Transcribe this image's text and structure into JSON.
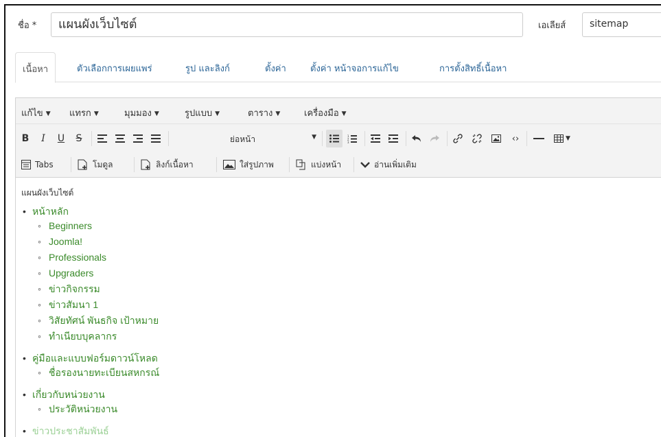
{
  "form": {
    "title_label": "ชื่อ *",
    "title_value": "แผนผังเว็บไซต์",
    "alias_label": "เอเลียส์",
    "alias_value": "sitemap"
  },
  "tabs": [
    {
      "label": "เนื้อหา",
      "active": true
    },
    {
      "label": "ตัวเลือกการเผยแพร่",
      "active": false
    },
    {
      "label": "รูป และลิงก์",
      "active": false
    },
    {
      "label": "ตั้งค่า",
      "active": false
    },
    {
      "label": "ตั้งค่า หน้าจอการแก้ไข",
      "active": false
    },
    {
      "label": "การตั้งสิทธิ์เนื้อหา",
      "active": false
    }
  ],
  "editor": {
    "menus": [
      "แก้ไข",
      "แทรก",
      "มุมมอง",
      "รูปแบบ",
      "ตาราง",
      "เครื่องมือ"
    ],
    "format_select": "ย่อหน้า",
    "buttons_row2": [
      {
        "label": "Tabs",
        "icon": "tabs-icon"
      },
      {
        "label": "โมดูล",
        "icon": "module-icon"
      },
      {
        "label": "ลิงก์เนื้อหา",
        "icon": "article-link-icon"
      },
      {
        "label": "ใส่รูปภาพ",
        "icon": "image-icon"
      },
      {
        "label": "แบ่งหน้า",
        "icon": "pagebreak-icon"
      },
      {
        "label": "อ่านเพิ่มเติม",
        "icon": "readmore-icon"
      }
    ]
  },
  "content": {
    "heading": "แผนผังเว็บไซต์",
    "sections": [
      {
        "label": "หน้าหลัก",
        "children": [
          "Beginners",
          "Joomla!",
          "Professionals",
          "Upgraders",
          "ข่าวกิจกรรม",
          "ข่าวสัมนา 1",
          "วิสัยทัศน์ พันธกิจ เป้าหมาย",
          "ทำเนียบบุคลากร"
        ]
      },
      {
        "label": "คู่มือและแบบฟอร์มดาวน์โหลด",
        "children": [
          "ชื่อรองนายทะเบียนสหกรณ์"
        ]
      },
      {
        "label": "เกี่ยวกับหน่วยงาน",
        "children": [
          "ประวัติหน่วยงาน"
        ]
      }
    ],
    "cut_off_item": "ข่าวประชาสัมพันธ์"
  },
  "colors": {
    "link_green": "#3a8a2a",
    "tab_link": "#2a6496"
  }
}
